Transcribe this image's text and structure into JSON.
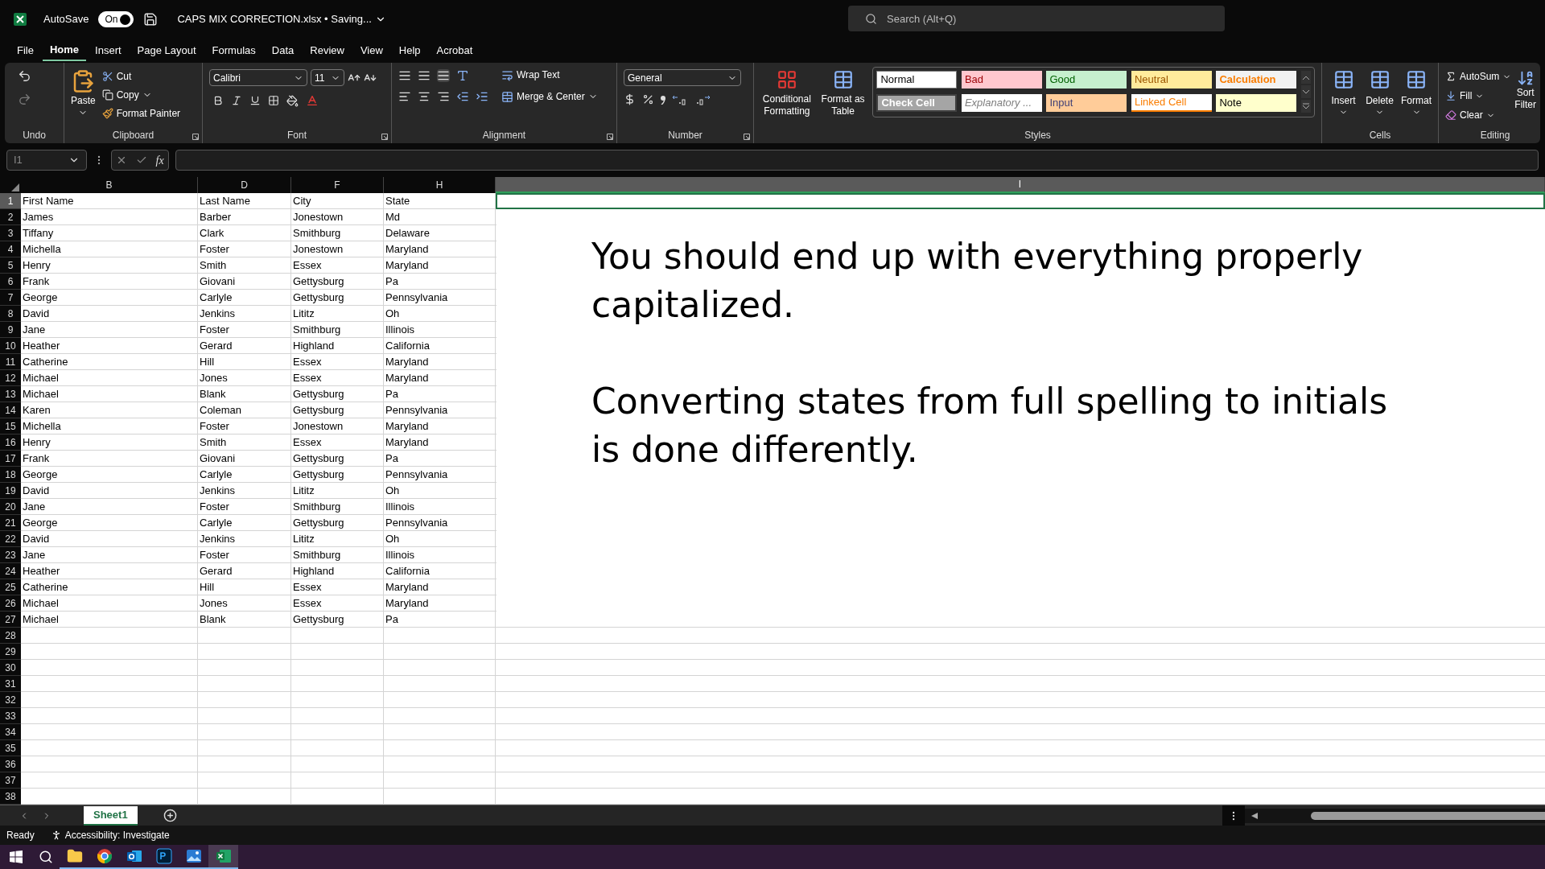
{
  "title_bar": {
    "autosave_label": "AutoSave",
    "autosave": {
      "on": true,
      "label": "On"
    },
    "filename": "CAPS MIX CORRECTION.xlsx • Saving...",
    "search_placeholder": "Search (Alt+Q)"
  },
  "menu_tabs": [
    {
      "label": "File",
      "selected": false
    },
    {
      "label": "Home",
      "selected": true
    },
    {
      "label": "Insert",
      "selected": false
    },
    {
      "label": "Page Layout",
      "selected": false
    },
    {
      "label": "Formulas",
      "selected": false
    },
    {
      "label": "Data",
      "selected": false
    },
    {
      "label": "Review",
      "selected": false
    },
    {
      "label": "View",
      "selected": false
    },
    {
      "label": "Help",
      "selected": false
    },
    {
      "label": "Acrobat",
      "selected": false
    }
  ],
  "ribbon": {
    "undo": {
      "label": "Undo"
    },
    "clipboard": {
      "paste": "Paste",
      "cut": "Cut",
      "copy": "Copy",
      "format_painter": "Format Painter",
      "label": "Clipboard"
    },
    "font": {
      "name": "Calibri",
      "size": "11",
      "label": "Font"
    },
    "alignment": {
      "wrap_text": "Wrap Text",
      "merge_center": "Merge & Center",
      "label": "Alignment"
    },
    "number": {
      "format": "General",
      "label": "Number"
    },
    "styles": {
      "conditional": [
        "Conditional",
        "Formatting"
      ],
      "format_table": [
        "Format as",
        "Table"
      ],
      "label": "Styles",
      "cells": [
        {
          "label": "Normal",
          "kind": "normal"
        },
        {
          "label": "Bad",
          "kind": "bad"
        },
        {
          "label": "Good",
          "kind": "good"
        },
        {
          "label": "Neutral",
          "kind": "neutral"
        },
        {
          "label": "Calculation",
          "kind": "calculation"
        },
        {
          "label": "Check Cell",
          "kind": "check"
        },
        {
          "label": "Explanatory ...",
          "kind": "explanatory"
        },
        {
          "label": "Input",
          "kind": "input"
        },
        {
          "label": "Linked Cell",
          "kind": "linked"
        },
        {
          "label": "Note",
          "kind": "note"
        }
      ]
    },
    "cells": {
      "buttons": [
        "Insert",
        "Delete",
        "Format"
      ],
      "label": "Cells"
    },
    "editing": {
      "autosum": "AutoSum",
      "fill": "Fill",
      "clear": "Clear",
      "sort": [
        "Sort",
        "Filter"
      ],
      "label": "Editing"
    }
  },
  "formula_bar": {
    "name_box": "I1",
    "function_label": "fx"
  },
  "columns": [
    {
      "label": "B",
      "selected": false
    },
    {
      "label": "D",
      "selected": false
    },
    {
      "label": "F",
      "selected": false
    },
    {
      "label": "H",
      "selected": false
    },
    {
      "label": "I",
      "selected": true
    }
  ],
  "rows": [
    {
      "number": "1",
      "selected": true,
      "cells": [
        "First Name",
        "Last Name",
        "City",
        "State"
      ]
    },
    {
      "number": "2",
      "selected": false,
      "cells": [
        "James",
        "Barber",
        "Jonestown",
        "Md"
      ]
    },
    {
      "number": "3",
      "selected": false,
      "cells": [
        "Tiffany",
        "Clark",
        "Smithburg",
        "Delaware"
      ]
    },
    {
      "number": "4",
      "selected": false,
      "cells": [
        "Michella",
        "Foster",
        "Jonestown",
        "Maryland"
      ]
    },
    {
      "number": "5",
      "selected": false,
      "cells": [
        "Henry",
        "Smith",
        "Essex",
        "Maryland"
      ]
    },
    {
      "number": "6",
      "selected": false,
      "cells": [
        "Frank",
        "Giovani",
        "Gettysburg",
        "Pa"
      ]
    },
    {
      "number": "7",
      "selected": false,
      "cells": [
        "George",
        "Carlyle",
        "Gettysburg",
        "Pennsylvania"
      ]
    },
    {
      "number": "8",
      "selected": false,
      "cells": [
        "David",
        "Jenkins",
        "Lititz",
        "Oh"
      ]
    },
    {
      "number": "9",
      "selected": false,
      "cells": [
        "Jane",
        "Foster",
        "Smithburg",
        "Illinois"
      ]
    },
    {
      "number": "10",
      "selected": false,
      "cells": [
        "Heather",
        "Gerard",
        "Highland",
        "California"
      ]
    },
    {
      "number": "11",
      "selected": false,
      "cells": [
        "Catherine",
        "Hill",
        "Essex",
        "Maryland"
      ]
    },
    {
      "number": "12",
      "selected": false,
      "cells": [
        "Michael",
        "Jones",
        "Essex",
        "Maryland"
      ]
    },
    {
      "number": "13",
      "selected": false,
      "cells": [
        "Michael",
        "Blank",
        "Gettysburg",
        "Pa"
      ]
    },
    {
      "number": "14",
      "selected": false,
      "cells": [
        "Karen",
        "Coleman",
        "Gettysburg",
        "Pennsylvania"
      ]
    },
    {
      "number": "15",
      "selected": false,
      "cells": [
        "Michella",
        "Foster",
        "Jonestown",
        "Maryland"
      ]
    },
    {
      "number": "16",
      "selected": false,
      "cells": [
        "Henry",
        "Smith",
        "Essex",
        "Maryland"
      ]
    },
    {
      "number": "17",
      "selected": false,
      "cells": [
        "Frank",
        "Giovani",
        "Gettysburg",
        "Pa"
      ]
    },
    {
      "number": "18",
      "selected": false,
      "cells": [
        "George",
        "Carlyle",
        "Gettysburg",
        "Pennsylvania"
      ]
    },
    {
      "number": "19",
      "selected": false,
      "cells": [
        "David",
        "Jenkins",
        "Lititz",
        "Oh"
      ]
    },
    {
      "number": "20",
      "selected": false,
      "cells": [
        "Jane",
        "Foster",
        "Smithburg",
        "Illinois"
      ]
    },
    {
      "number": "21",
      "selected": false,
      "cells": [
        "George",
        "Carlyle",
        "Gettysburg",
        "Pennsylvania"
      ]
    },
    {
      "number": "22",
      "selected": false,
      "cells": [
        "David",
        "Jenkins",
        "Lititz",
        "Oh"
      ]
    },
    {
      "number": "23",
      "selected": false,
      "cells": [
        "Jane",
        "Foster",
        "Smithburg",
        "Illinois"
      ]
    },
    {
      "number": "24",
      "selected": false,
      "cells": [
        "Heather",
        "Gerard",
        "Highland",
        "California"
      ]
    },
    {
      "number": "25",
      "selected": false,
      "cells": [
        "Catherine",
        "Hill",
        "Essex",
        "Maryland"
      ]
    },
    {
      "number": "26",
      "selected": false,
      "cells": [
        "Michael",
        "Jones",
        "Essex",
        "Maryland"
      ]
    },
    {
      "number": "27",
      "selected": false,
      "cells": [
        "Michael",
        "Blank",
        "Gettysburg",
        "Pa"
      ]
    },
    {
      "number": "28",
      "selected": false
    },
    {
      "number": "29",
      "selected": false
    },
    {
      "number": "30",
      "selected": false
    },
    {
      "number": "31",
      "selected": false
    },
    {
      "number": "32",
      "selected": false
    },
    {
      "number": "33",
      "selected": false
    },
    {
      "number": "34",
      "selected": false
    },
    {
      "number": "35",
      "selected": false
    },
    {
      "number": "36",
      "selected": false
    },
    {
      "number": "37",
      "selected": false
    },
    {
      "number": "38",
      "selected": false
    }
  ],
  "text_box": [
    "You should end up with everything properly capitalized.",
    "Converting states from full spelling to initials is done differently."
  ],
  "sheet_tabs": [
    {
      "label": "Sheet1",
      "selected": true
    }
  ],
  "status_bar": {
    "ready": "Ready",
    "accessibility": "Accessibility: Investigate"
  },
  "taskbar": [
    {
      "kind": "folder",
      "active": false
    },
    {
      "kind": "chrome",
      "active": false
    },
    {
      "kind": "outlook",
      "active": false
    },
    {
      "kind": "photoshop",
      "active": false
    },
    {
      "kind": "photos",
      "active": false
    },
    {
      "kind": "excel",
      "active": true
    }
  ]
}
